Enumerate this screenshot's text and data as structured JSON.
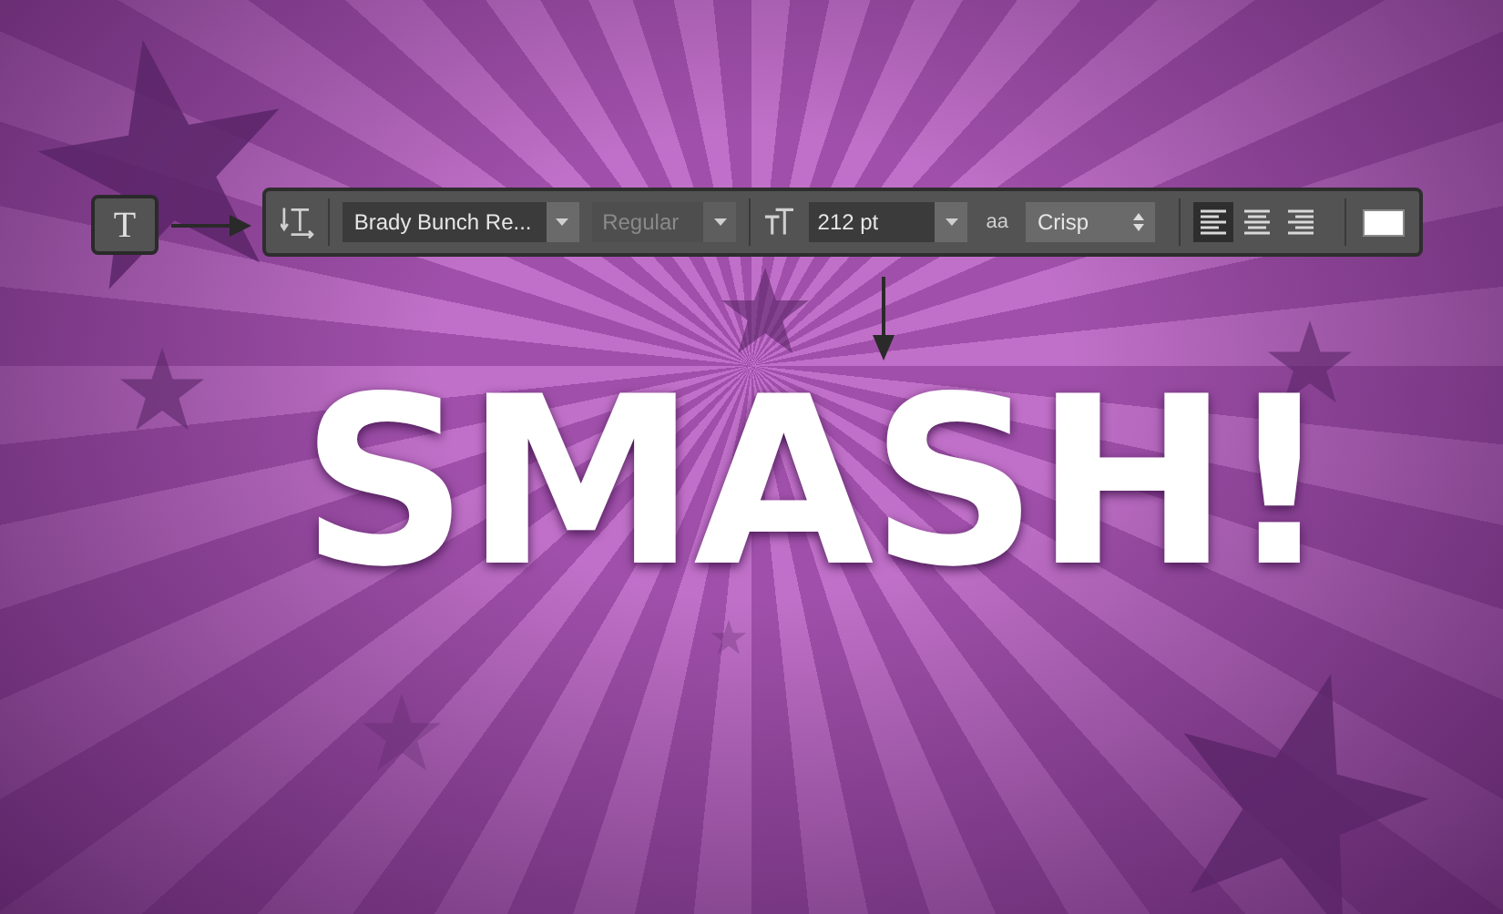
{
  "tool_button": {
    "label": "T"
  },
  "options_bar": {
    "font_family": "Brady Bunch Re...",
    "font_style": {
      "value": "Regular",
      "disabled": true
    },
    "font_size": "212 pt",
    "antialias_icon": "aa",
    "antialiasing": "Crisp",
    "alignment": [
      {
        "kind": "left",
        "selected": true
      },
      {
        "kind": "center",
        "selected": false
      },
      {
        "kind": "right",
        "selected": false
      }
    ]
  },
  "canvas": {
    "headline": "SMASH!"
  }
}
